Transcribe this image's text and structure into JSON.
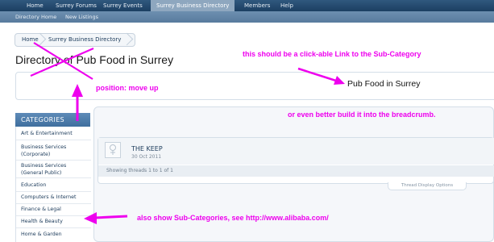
{
  "topnav": {
    "tabs": [
      "Home",
      "Surrey Forums",
      "Surrey Events",
      "Surrey Business Directory",
      "Members",
      "Help"
    ]
  },
  "subnav": {
    "links": [
      "Directory Home",
      "New Listings"
    ]
  },
  "breadcrumb": [
    "Home",
    "Surrey Business Directory"
  ],
  "page": {
    "title": "Directory of Pub Food in Surrey",
    "description": "Pub Food in Surrey"
  },
  "sidebar": {
    "header": "CATEGORIES",
    "items": [
      "Art & Entertainment",
      "Business Services (Corporate)",
      "Business Services (General Public)",
      "Education",
      "Computers & Internet",
      "Finance & Legal",
      "Health & Beauty",
      "Home & Garden"
    ]
  },
  "thread": {
    "title": "THE KEEP",
    "date": "30 Oct 2011",
    "showing": "Showing threads 1 to 1 of 1",
    "display_options": "Thread Display Options"
  },
  "annotations": {
    "link_note": "this should be a click-able Link to the Sub-Category",
    "position_note": "position: move up",
    "breadcrumb_note": "or even better build it into the breadcrumb.",
    "subcat_note": "also show Sub-Categories, see http://www.alibaba.com/"
  },
  "colors": {
    "annotation": "#ee00ee",
    "nav_dark": "#1c3f62",
    "nav_active": "#8ea7bf",
    "link": "#1b3a5a"
  }
}
